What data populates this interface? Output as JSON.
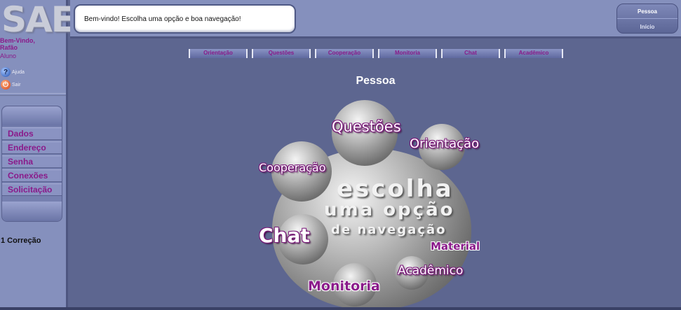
{
  "app": {
    "logo": "SAE"
  },
  "sidebar": {
    "welcome_line1": "Bem-Vindo,",
    "welcome_line2": "Rafão",
    "role": "Aluno",
    "help_label": "Ajuda",
    "exit_label": "Sair",
    "menu": [
      "Dados",
      "Endereço",
      "Senha",
      "Conexões",
      "Solicitação"
    ],
    "corrections": "1 Correção"
  },
  "header": {
    "welcome_message": "Bem-vindo! Escolha uma opção e boa navegação!",
    "pessoa_button": "Pessoa",
    "inicio_button": "Início"
  },
  "tabs": [
    "Orientação",
    "Questões",
    "Cooperação",
    "Monitoria",
    "Chat",
    "Acadêmico"
  ],
  "page_title": "Pessoa",
  "graphic": {
    "center_line1": "escolha",
    "center_line2": "uma opção",
    "center_line3": "de navegação",
    "options": {
      "questoes": "Questões",
      "orientacao": "Orientação",
      "cooperacao": "Cooperação",
      "chat": "Chat",
      "material": "Material",
      "academico": "Acadêmico",
      "monitoria": "Monitoria"
    }
  },
  "colors": {
    "accent": "#8a1a8a",
    "background": "#5d6690",
    "panel": "#8590bd"
  },
  "icons": {
    "help": "help-icon",
    "exit": "power-icon"
  }
}
